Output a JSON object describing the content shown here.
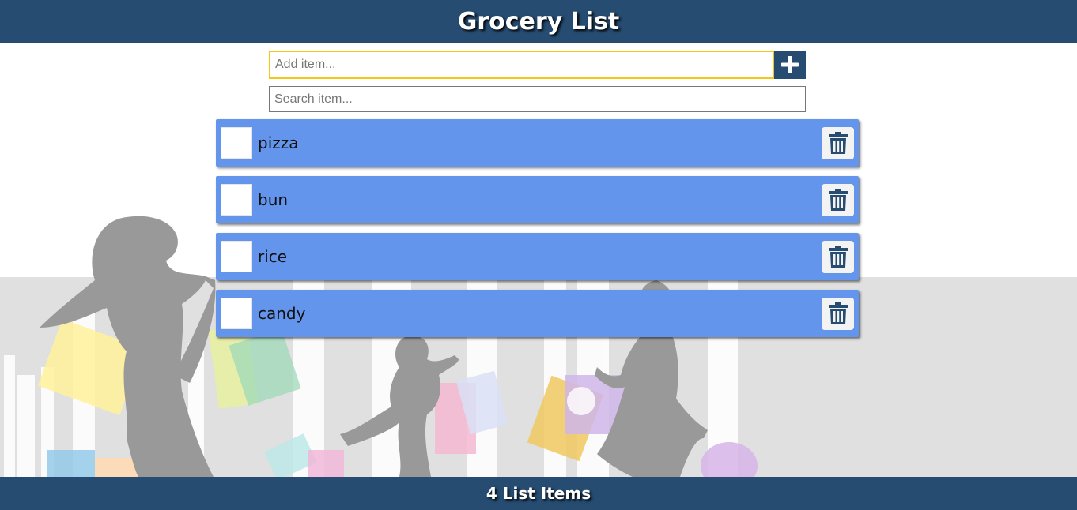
{
  "header": {
    "title": "Grocery List"
  },
  "add_item": {
    "placeholder": "Add item...",
    "value": "",
    "button_icon": "plus-icon"
  },
  "search": {
    "placeholder": "Search item...",
    "value": ""
  },
  "items": [
    {
      "label": "pizza",
      "checked": false,
      "delete_icon": "trash-icon"
    },
    {
      "label": "bun",
      "checked": false,
      "delete_icon": "trash-icon"
    },
    {
      "label": "rice",
      "checked": false,
      "delete_icon": "trash-icon"
    },
    {
      "label": "candy",
      "checked": false,
      "delete_icon": "trash-icon"
    }
  ],
  "footer": {
    "count_text": "4 List Items"
  },
  "colors": {
    "header_bg": "#264c72",
    "item_bg": "#6495ed",
    "add_input_border": "#f5c518",
    "background_illustration": "#9a9a9a"
  }
}
